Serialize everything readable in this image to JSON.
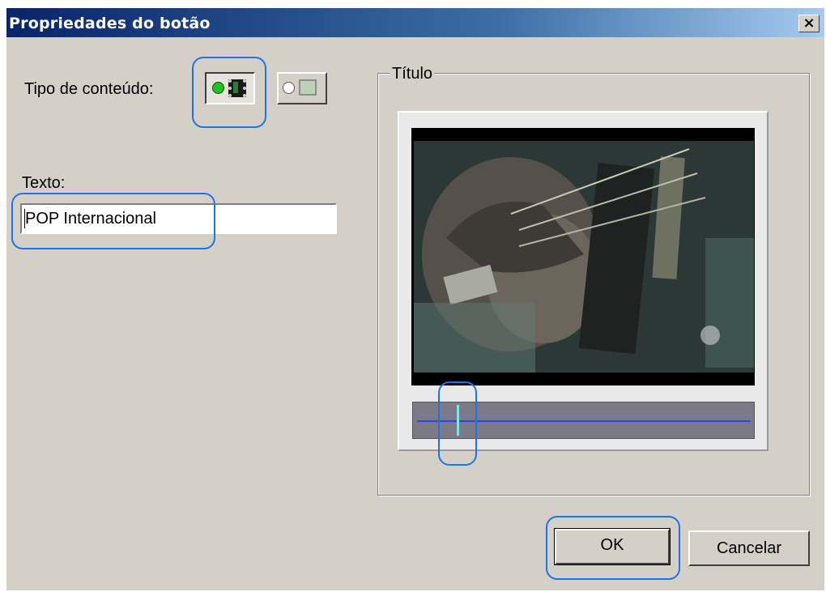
{
  "window": {
    "title": "Propriedades do botão",
    "close_glyph": "×"
  },
  "content_type": {
    "label": "Tipo de conteúdo:",
    "options": [
      {
        "name": "video",
        "icons": [
          "green-dot-icon",
          "film-icon"
        ],
        "selected": true
      },
      {
        "name": "image",
        "icons": [
          "empty-dot-icon",
          "image-icon"
        ],
        "selected": false
      }
    ]
  },
  "text_field": {
    "label": "Texto:",
    "value": "POP Internacional"
  },
  "preview": {
    "group_title": "Título",
    "playhead_position_fraction": 0.12
  },
  "buttons": {
    "ok": "OK",
    "cancel": "Cancelar"
  },
  "colors": {
    "title_bar_start": "#0a246a",
    "title_bar_end": "#a6caf0",
    "dialog_bg": "#d4d0c8",
    "annotation": "#1d73e8",
    "playhead": "#7de8e8",
    "timeline_line": "#2f40ff"
  }
}
